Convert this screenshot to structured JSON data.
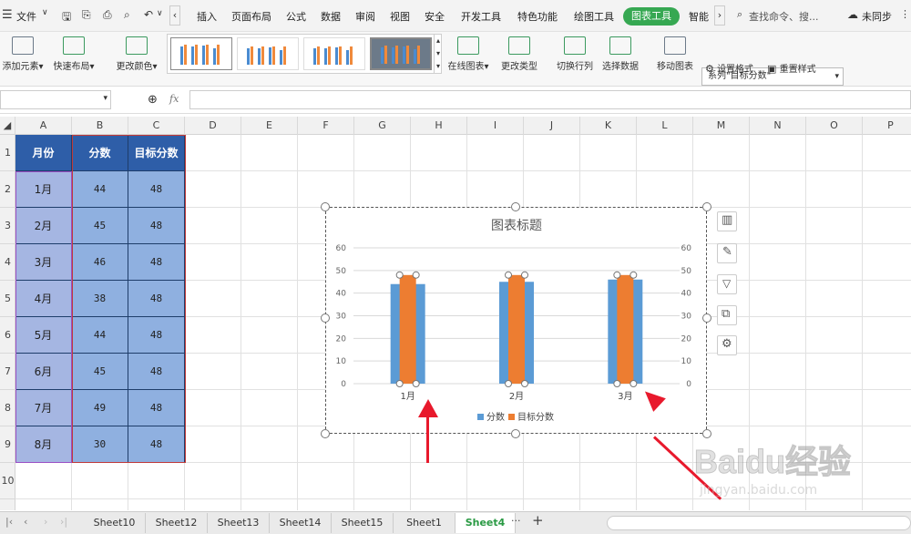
{
  "menubar": {
    "file": "文件",
    "items": [
      "插入",
      "页面布局",
      "公式",
      "数据",
      "审阅",
      "视图",
      "安全",
      "开发工具",
      "特色功能",
      "绘图工具"
    ],
    "active_tab": "图表工具",
    "smart": "智能",
    "search": "查找命令、搜...",
    "sync": "未同步"
  },
  "ribbon": {
    "add_element": "添加元素",
    "quick_layout": "快速布局",
    "change_color": "更改颜色",
    "online_chart": "在线图表",
    "change_type": "更改类型",
    "switch_row_col": "切换行列",
    "select_data": "选择数据",
    "move_chart": "移动图表",
    "series_select": "系列\"目标分数\"",
    "set_format": "设置格式",
    "reset_style": "重置样式"
  },
  "formula": {
    "fx": "fx"
  },
  "columns": [
    "A",
    "B",
    "C",
    "D",
    "E",
    "F",
    "G",
    "H",
    "I",
    "J",
    "K",
    "L",
    "M",
    "N",
    "O",
    "P"
  ],
  "rows": [
    "1",
    "2",
    "3",
    "4",
    "5",
    "6",
    "7",
    "8",
    "9",
    "10"
  ],
  "table": {
    "headers": [
      "月份",
      "分数",
      "目标分数"
    ],
    "rows": [
      [
        "1月",
        "44",
        "48"
      ],
      [
        "2月",
        "45",
        "48"
      ],
      [
        "3月",
        "46",
        "48"
      ],
      [
        "4月",
        "38",
        "48"
      ],
      [
        "5月",
        "44",
        "48"
      ],
      [
        "6月",
        "45",
        "48"
      ],
      [
        "7月",
        "49",
        "48"
      ],
      [
        "8月",
        "30",
        "48"
      ]
    ]
  },
  "chart_data": {
    "type": "bar",
    "title": "图表标题",
    "categories": [
      "1月",
      "2月",
      "3月"
    ],
    "series": [
      {
        "name": "分数",
        "values": [
          44,
          45,
          46
        ],
        "color": "#5b9bd5"
      },
      {
        "name": "目标分数",
        "values": [
          48,
          48,
          48
        ],
        "color": "#ed7d31"
      }
    ],
    "ylim": [
      0,
      60
    ],
    "yticks": [
      0,
      10,
      20,
      30,
      40,
      50,
      60
    ],
    "secondary_axis": true,
    "grid": true,
    "legend": "bottom"
  },
  "sheets": [
    "Sheet10",
    "Sheet12",
    "Sheet13",
    "Sheet14",
    "Sheet15",
    "Sheet1",
    "Sheet4"
  ],
  "active_sheet": "Sheet4",
  "tabbar": {
    "more": "···",
    "add": "+"
  },
  "watermark": {
    "text": "Baidu经验",
    "url": "jingyan.baidu.com"
  }
}
